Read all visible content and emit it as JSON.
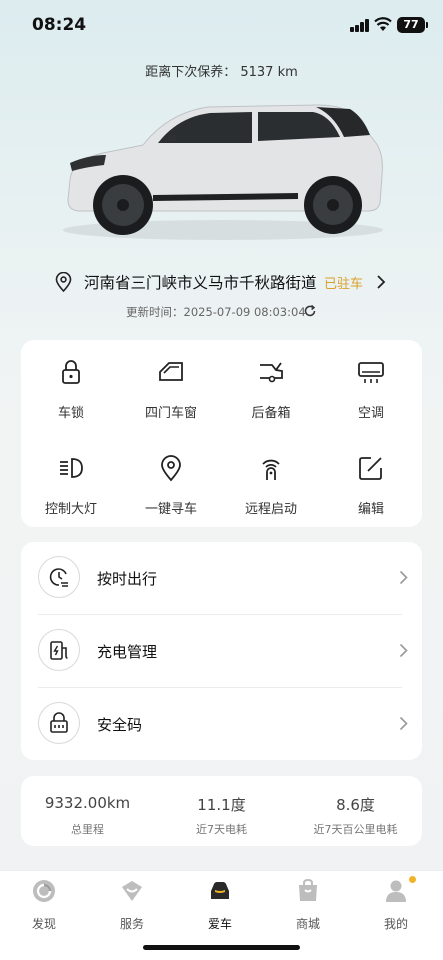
{
  "status_bar": {
    "time": "08:24",
    "battery": "77"
  },
  "maintenance": {
    "text": "距离下次保养：  5137 km"
  },
  "location": {
    "address": "河南省三门峡市义马市千秋路街道",
    "status": "已驻车",
    "updated": "更新时间：2025-07-09 08:03:04"
  },
  "controls": [
    {
      "label": "车锁",
      "icon": "lock-icon"
    },
    {
      "label": "四门车窗",
      "icon": "window-icon"
    },
    {
      "label": "后备箱",
      "icon": "trunk-icon"
    },
    {
      "label": "空调",
      "icon": "ac-icon"
    },
    {
      "label": "控制大灯",
      "icon": "headlight-icon"
    },
    {
      "label": "一键寻车",
      "icon": "locate-car-icon"
    },
    {
      "label": "远程启动",
      "icon": "remote-start-icon"
    },
    {
      "label": "编辑",
      "icon": "edit-icon"
    }
  ],
  "services": [
    {
      "label": "按时出行",
      "icon": "scheduled-departure-icon"
    },
    {
      "label": "充电管理",
      "icon": "charging-icon"
    },
    {
      "label": "安全码",
      "icon": "security-code-icon"
    }
  ],
  "stats": [
    {
      "value": "9332.00km",
      "label": "总里程"
    },
    {
      "value": "11.1度",
      "label": "近7天电耗"
    },
    {
      "value": "8.6度",
      "label": "近7天百公里电耗"
    }
  ],
  "tabs": [
    {
      "label": "发现",
      "icon": "discover-icon"
    },
    {
      "label": "服务",
      "icon": "service-icon"
    },
    {
      "label": "爱车",
      "icon": "car-icon",
      "active": true
    },
    {
      "label": "商城",
      "icon": "shop-icon"
    },
    {
      "label": "我的",
      "icon": "profile-icon"
    }
  ],
  "colors": {
    "accent": "#d9a12b",
    "badge": "#f0b429"
  }
}
